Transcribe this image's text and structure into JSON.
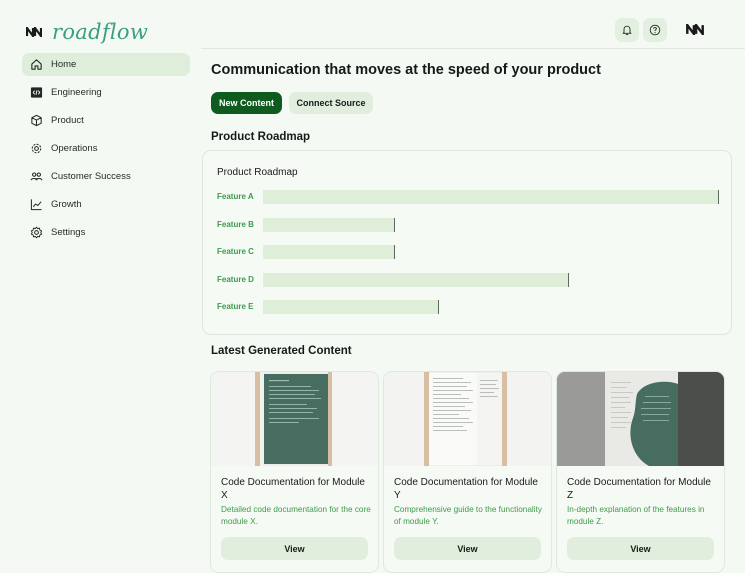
{
  "brand": {
    "name": "roadflow",
    "accent": "#3a9e80"
  },
  "nav": {
    "items": [
      {
        "label": "Home",
        "icon": "home-icon"
      },
      {
        "label": "Engineering",
        "icon": "code-icon"
      },
      {
        "label": "Product",
        "icon": "cube-icon"
      },
      {
        "label": "Operations",
        "icon": "gear-icon"
      },
      {
        "label": "Customer Success",
        "icon": "users-icon"
      },
      {
        "label": "Growth",
        "icon": "chart-line-icon"
      },
      {
        "label": "Settings",
        "icon": "settings-icon"
      }
    ],
    "active": "Home"
  },
  "topbar": {
    "icons": [
      "bell-icon",
      "help-icon"
    ]
  },
  "main": {
    "headline": "Communication that moves at the speed of your product",
    "new_content_label": "New Content",
    "connect_source_label": "Connect Source",
    "roadmap_section_title": "Product Roadmap",
    "latest_section_title": "Latest Generated Content"
  },
  "roadmap": {
    "title": "Product Roadmap",
    "features": [
      {
        "label": "Feature A",
        "progress": 1.0
      },
      {
        "label": "Feature B",
        "progress": 0.29
      },
      {
        "label": "Feature C",
        "progress": 0.29
      },
      {
        "label": "Feature D",
        "progress": 0.67
      },
      {
        "label": "Feature E",
        "progress": 0.385
      }
    ],
    "colors": {
      "label": "#3f9a4f",
      "bar": "#dfeed9",
      "marker": "#5e6a5f"
    }
  },
  "content_cards": [
    {
      "title": "Code Documentation for Module X",
      "description": "Detailed code documentation for the core module X.",
      "button": "View"
    },
    {
      "title": "Code Documentation for Module Y",
      "description": "Comprehensive guide to the functionality of module Y.",
      "button": "View"
    },
    {
      "title": "Code Documentation for Module Z",
      "description": "In-depth explanation of the features in module Z.",
      "button": "View"
    }
  ],
  "colors": {
    "primary": "#0f5a1e",
    "background": "#f4f9f3",
    "soft": "#e1eedd"
  }
}
